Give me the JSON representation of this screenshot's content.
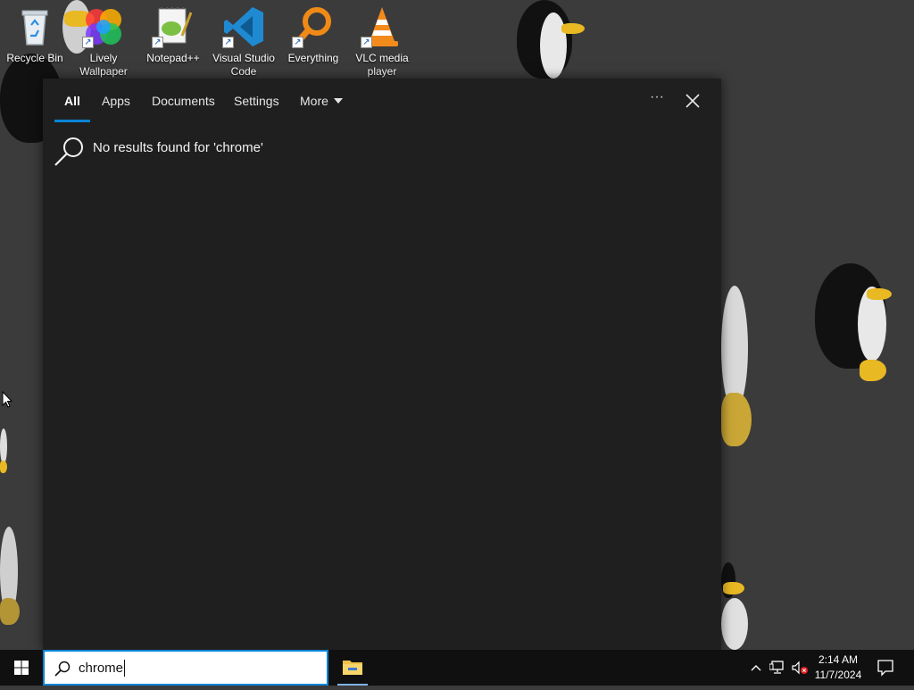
{
  "desktop": {
    "icons": [
      {
        "label": "Recycle Bin"
      },
      {
        "label": "Lively Wallpaper"
      },
      {
        "label": "Notepad++"
      },
      {
        "label": "Visual Studio Code"
      },
      {
        "label": "Everything"
      },
      {
        "label": "VLC media player"
      }
    ]
  },
  "search_panel": {
    "tabs": [
      {
        "label": "All",
        "active": true
      },
      {
        "label": "Apps"
      },
      {
        "label": "Documents"
      },
      {
        "label": "Settings"
      },
      {
        "label": "More"
      }
    ],
    "ellipsis": "···",
    "no_results_message": "No results found for 'chrome'"
  },
  "taskbar": {
    "search_value": "chrome",
    "clock": {
      "time": "2:14 AM",
      "date": "11/7/2024"
    }
  },
  "colors": {
    "accent": "#0a84d6",
    "panel_bg": "#1f1f1f",
    "taskbar_bg": "#101010"
  }
}
